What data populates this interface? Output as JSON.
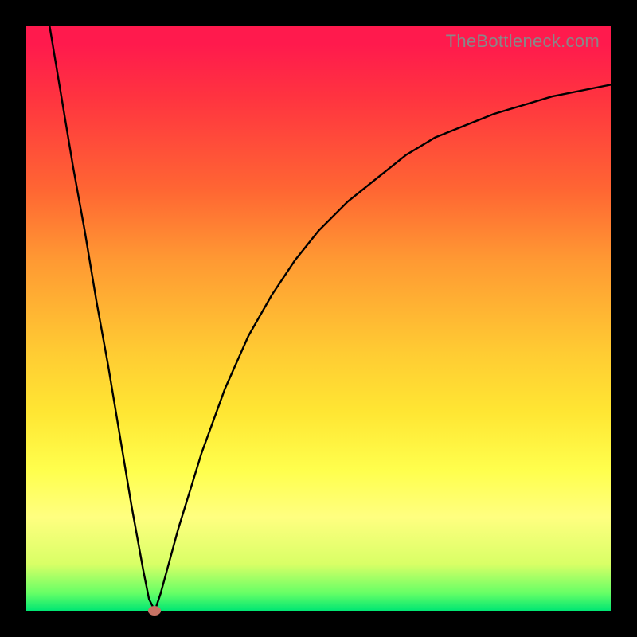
{
  "watermark": "TheBottleneck.com",
  "chart_data": {
    "type": "line",
    "title": "",
    "xlabel": "",
    "ylabel": "",
    "xlim": [
      0,
      100
    ],
    "ylim": [
      0,
      100
    ],
    "grid": false,
    "legend": false,
    "series": [
      {
        "name": "curve",
        "x": [
          4,
          6,
          8,
          10,
          12,
          14,
          16,
          18,
          20,
          21,
          22,
          23,
          26,
          30,
          34,
          38,
          42,
          46,
          50,
          55,
          60,
          65,
          70,
          75,
          80,
          85,
          90,
          95,
          100
        ],
        "y": [
          100,
          88,
          76,
          65,
          53,
          42,
          30,
          18,
          7,
          2,
          0,
          3,
          14,
          27,
          38,
          47,
          54,
          60,
          65,
          70,
          74,
          78,
          81,
          83,
          85,
          86.5,
          88,
          89,
          90
        ]
      }
    ],
    "marker": {
      "x": 22,
      "y": 0,
      "color": "#c77264"
    },
    "gradient_stops": [
      {
        "pos": 0,
        "color": "#ff1a4d"
      },
      {
        "pos": 12,
        "color": "#ff3340"
      },
      {
        "pos": 28,
        "color": "#ff6633"
      },
      {
        "pos": 40,
        "color": "#ff9933"
      },
      {
        "pos": 56,
        "color": "#ffcc33"
      },
      {
        "pos": 66,
        "color": "#ffe633"
      },
      {
        "pos": 76,
        "color": "#ffff4d"
      },
      {
        "pos": 84,
        "color": "#ffff80"
      },
      {
        "pos": 92,
        "color": "#d9ff66"
      },
      {
        "pos": 97,
        "color": "#66ff66"
      },
      {
        "pos": 100,
        "color": "#00e673"
      }
    ]
  }
}
